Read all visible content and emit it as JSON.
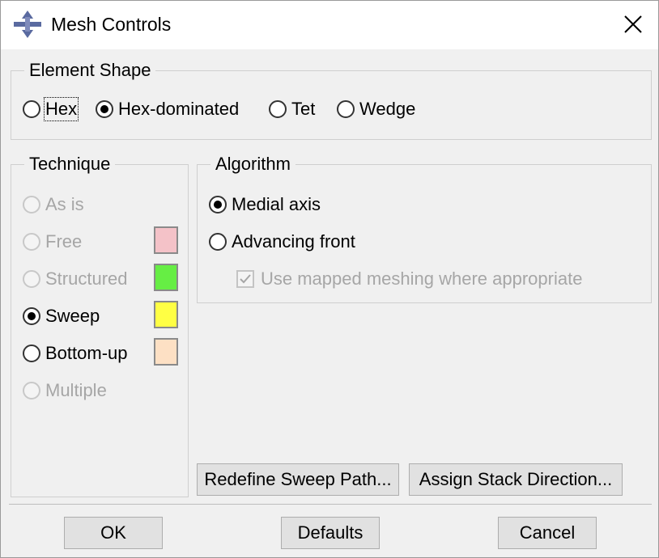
{
  "window": {
    "title": "Mesh Controls"
  },
  "element_shape": {
    "legend": "Element Shape",
    "options": [
      {
        "label": "Hex",
        "checked": false
      },
      {
        "label": "Hex-dominated",
        "checked": true
      },
      {
        "label": "Tet",
        "checked": false
      },
      {
        "label": "Wedge",
        "checked": false
      }
    ]
  },
  "technique": {
    "legend": "Technique",
    "options": [
      {
        "label": "As is",
        "checked": false,
        "enabled": false
      },
      {
        "label": "Free",
        "checked": false,
        "enabled": false,
        "color": "#f4c2c8"
      },
      {
        "label": "Structured",
        "checked": false,
        "enabled": false,
        "color": "#66ee44"
      },
      {
        "label": "Sweep",
        "checked": true,
        "enabled": true,
        "color": "#ffff44"
      },
      {
        "label": "Bottom-up",
        "checked": false,
        "enabled": true,
        "color": "#fde0c4"
      },
      {
        "label": "Multiple",
        "checked": false,
        "enabled": false
      }
    ]
  },
  "algorithm": {
    "legend": "Algorithm",
    "options": [
      {
        "label": "Medial axis",
        "checked": true
      },
      {
        "label": "Advancing front",
        "checked": false
      }
    ],
    "mapped_meshing": {
      "label": "Use mapped meshing where appropriate",
      "checked": true,
      "enabled": false
    }
  },
  "buttons": {
    "redefine_sweep_path": "Redefine Sweep Path...",
    "assign_stack_direction": "Assign Stack Direction...",
    "ok": "OK",
    "defaults": "Defaults",
    "cancel": "Cancel"
  }
}
